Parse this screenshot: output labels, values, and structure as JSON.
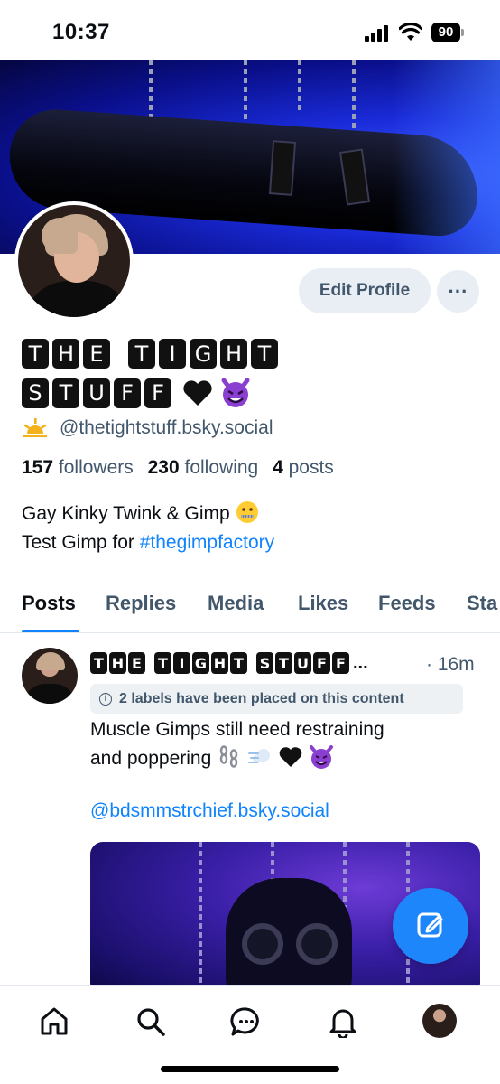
{
  "status_bar": {
    "time": "10:37",
    "battery": "90"
  },
  "profile": {
    "edit_label": "Edit Profile",
    "more_label": "···",
    "name_line1": [
      "T",
      "H",
      "E",
      " ",
      "T",
      "I",
      "G",
      "H",
      "T"
    ],
    "name_line2": [
      "S",
      "T",
      "U",
      "F",
      "F"
    ],
    "handle": "@thetightstuff.bsky.social",
    "stats": {
      "followers_count": "157",
      "followers_label": "followers",
      "following_count": "230",
      "following_label": "following",
      "posts_count": "4",
      "posts_label": "posts"
    },
    "bio_line1": "Gay Kinky Twink & Gimp",
    "bio_line2_prefix": "Test Gimp for ",
    "bio_hashtag": "#thegimpfactory"
  },
  "tabs": [
    "Posts",
    "Replies",
    "Media",
    "Likes",
    "Feeds",
    "Sta"
  ],
  "active_tab": "Posts",
  "post": {
    "author_tiles": [
      "T",
      "H",
      "E",
      " ",
      "T",
      "I",
      "G",
      "H",
      "T",
      " ",
      "S",
      "T",
      "U",
      "F",
      "F"
    ],
    "author_ellipsis": "...",
    "time": "· 16m",
    "labels_text": "2 labels have been placed on this content",
    "text_line1": "Muscle Gimps still need restraining",
    "text_line2": "and poppering",
    "mention": "@bdsmmstrchief.bsky.social"
  },
  "colors": {
    "accent": "#1083fe",
    "muted": "#42576c",
    "fab": "#1d86fb"
  },
  "icons": {
    "nav": [
      "home-icon",
      "search-icon",
      "chat-icon",
      "bell-icon",
      "profile-avatar"
    ],
    "fab": "compose-icon"
  }
}
